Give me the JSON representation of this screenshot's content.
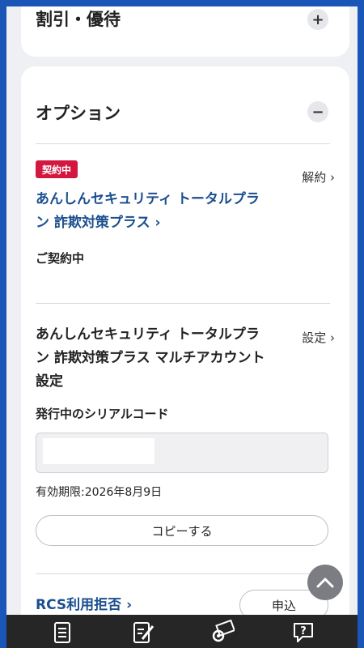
{
  "discount_section": {
    "title": "割引・優待",
    "toggle": "+"
  },
  "option_section": {
    "title": "オプション",
    "toggle": "−",
    "contract": {
      "badge": "契約中",
      "cancel_link": "解約",
      "plan_name_line1": "あんしんセキュリティ トータルプラ",
      "plan_name_line2": "ン 詐欺対策プラス",
      "status": "ご契約中"
    },
    "multi_account": {
      "settings_link": "設定",
      "title_line1": "あんしんセキュリティ トータルプラ",
      "title_line2": "ン 詐欺対策プラス マルチアカウント",
      "title_line3": "設定",
      "serial_label": "発行中のシリアルコード",
      "expiry": "有効期限:2026年8月9日",
      "copy_button": "コピーする"
    },
    "rcs": {
      "link": "RCS利用拒否",
      "apply_button": "申込"
    }
  },
  "bottom_nav": {
    "icons": [
      "document-icon",
      "edit-document-icon",
      "settings-mail-icon",
      "help-chat-icon"
    ]
  }
}
